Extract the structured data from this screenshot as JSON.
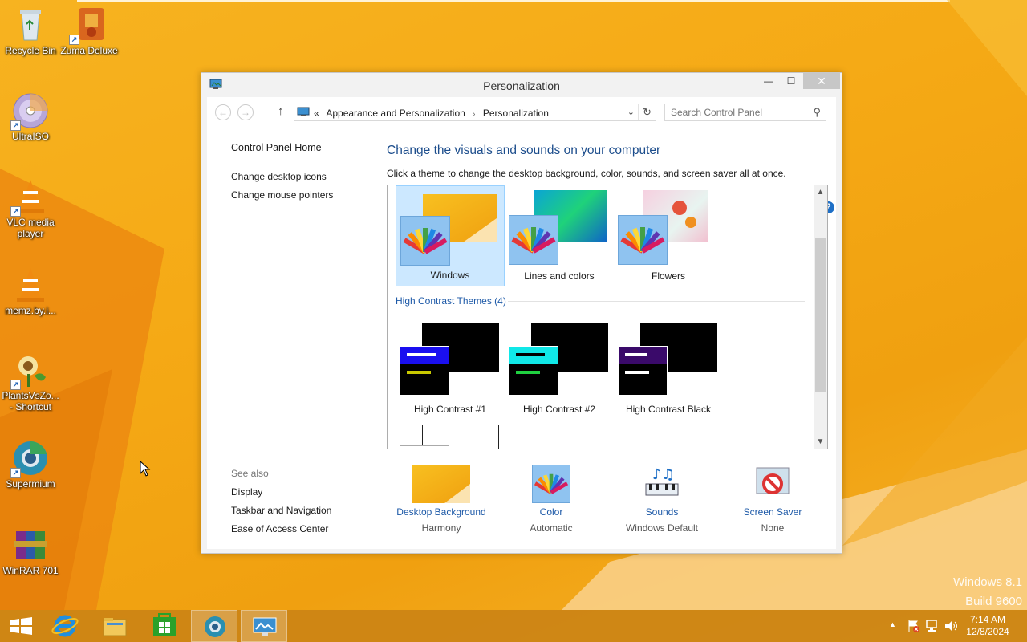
{
  "desktop": {
    "icons": [
      {
        "label": "Recycle Bin"
      },
      {
        "label": "Zuma Deluxe"
      },
      {
        "label": "UltraISO"
      },
      {
        "label": "VLC media player"
      },
      {
        "label": "memz.by.i..."
      },
      {
        "label": "PlantsVsZo... - Shortcut"
      },
      {
        "label": "Supermium"
      },
      {
        "label": "WinRAR 701"
      }
    ],
    "watermark_line1": "Windows 8.1",
    "watermark_line2": "Build 9600"
  },
  "window": {
    "title": "Personalization",
    "minimize_glyph": "—",
    "maximize_glyph": "☐",
    "close_glyph": "✕",
    "address": {
      "overflow": "«",
      "crumb1": "Appearance and Personalization",
      "separator": "›",
      "crumb2": "Personalization"
    },
    "search": {
      "placeholder": "Search Control Panel"
    },
    "help": "?",
    "left_pane": {
      "home": "Control Panel Home",
      "links": [
        "Change desktop icons",
        "Change mouse pointers"
      ],
      "see_also_title": "See also",
      "see_also": [
        "Display",
        "Taskbar and Navigation",
        "Ease of Access Center"
      ]
    },
    "heading": "Change the visuals and sounds on your computer",
    "subtext": "Click a theme to change the desktop background, color, sounds, and screen saver all at once.",
    "themes": [
      {
        "label": "Windows",
        "selected": true
      },
      {
        "label": "Lines and colors",
        "selected": false
      },
      {
        "label": "Flowers",
        "selected": false
      }
    ],
    "high_contrast_header": "High Contrast Themes (4)",
    "high_contrast": [
      {
        "label": "High Contrast #1"
      },
      {
        "label": "High Contrast #2"
      },
      {
        "label": "High Contrast Black"
      }
    ],
    "bottom": [
      {
        "label": "Desktop Background",
        "value": "Harmony"
      },
      {
        "label": "Color",
        "value": "Automatic"
      },
      {
        "label": "Sounds",
        "value": "Windows Default"
      },
      {
        "label": "Screen Saver",
        "value": "None"
      }
    ]
  },
  "taskbar": {
    "time": "7:14 AM",
    "date": "12/8/2024",
    "tray_arrow": "▲"
  }
}
